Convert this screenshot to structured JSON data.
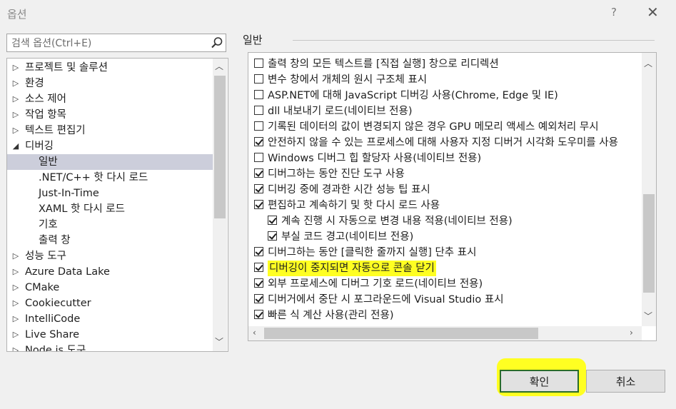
{
  "window": {
    "title": "옵션",
    "help": "?",
    "close": "✕"
  },
  "search": {
    "placeholder": "검색 옵션(Ctrl+E)"
  },
  "tree": {
    "items": [
      {
        "label": "프로젝트 및 솔루션",
        "arrow": "▷",
        "indent": 0
      },
      {
        "label": "환경",
        "arrow": "▷",
        "indent": 0
      },
      {
        "label": "소스 제어",
        "arrow": "▷",
        "indent": 0
      },
      {
        "label": "작업 항목",
        "arrow": "▷",
        "indent": 0
      },
      {
        "label": "텍스트 편집기",
        "arrow": "▷",
        "indent": 0
      },
      {
        "label": "디버깅",
        "arrow": "◢",
        "indent": 0
      },
      {
        "label": "일반",
        "arrow": "",
        "indent": 1,
        "selected": true
      },
      {
        "label": ".NET/C++ 핫 다시 로드",
        "arrow": "",
        "indent": 1
      },
      {
        "label": "Just-In-Time",
        "arrow": "",
        "indent": 1
      },
      {
        "label": "XAML 핫 다시 로드",
        "arrow": "",
        "indent": 1
      },
      {
        "label": "기호",
        "arrow": "",
        "indent": 1
      },
      {
        "label": "출력 창",
        "arrow": "",
        "indent": 1
      },
      {
        "label": "성능 도구",
        "arrow": "▷",
        "indent": 0
      },
      {
        "label": "Azure Data Lake",
        "arrow": "▷",
        "indent": 0
      },
      {
        "label": "CMake",
        "arrow": "▷",
        "indent": 0
      },
      {
        "label": "Cookiecutter",
        "arrow": "▷",
        "indent": 0
      },
      {
        "label": "IntelliCode",
        "arrow": "▷",
        "indent": 0
      },
      {
        "label": "Live Share",
        "arrow": "▷",
        "indent": 0
      },
      {
        "label": "Node.js 도구",
        "arrow": "▷",
        "indent": 0
      }
    ]
  },
  "section": {
    "title": "일반"
  },
  "options": [
    {
      "label": "출력 창의 모든 텍스트를 [직접 실행] 창으로 리디렉션",
      "checked": false,
      "indent": 0
    },
    {
      "label": "변수 창에서 개체의 원시 구조체 표시",
      "checked": false,
      "indent": 0
    },
    {
      "label": "ASP.NET에 대해 JavaScript 디버깅 사용(Chrome, Edge 및 IE)",
      "checked": false,
      "indent": 0
    },
    {
      "label": "dll 내보내기 로드(네이티브 전용)",
      "checked": false,
      "indent": 0
    },
    {
      "label": "기록된 데이터의 값이 변경되지 않은 경우 GPU 메모리 액세스 예외처리 무시",
      "checked": false,
      "indent": 0
    },
    {
      "label": "안전하지 않을 수 있는 프로세스에 대해 사용자 지정 디버거 시각화 도우미를 사용",
      "checked": true,
      "indent": 0
    },
    {
      "label": "Windows 디버그 힙 할당자 사용(네이티브 전용)",
      "checked": false,
      "indent": 0
    },
    {
      "label": "디버그하는 동안 진단 도구 사용",
      "checked": true,
      "indent": 0
    },
    {
      "label": "디버깅 중에 경과한 시간 성능 팁 표시",
      "checked": true,
      "indent": 0
    },
    {
      "label": "편집하고 계속하기 및 핫 다시 로드 사용",
      "checked": true,
      "indent": 0
    },
    {
      "label": "계속 진행 시 자동으로 변경 내용 적용(네이티브 전용)",
      "checked": true,
      "indent": 1
    },
    {
      "label": "부실 코드 경고(네이티브 전용)",
      "checked": true,
      "indent": 1
    },
    {
      "label": "디버그하는 동안 [클릭한 줄까지 실행] 단추 표시",
      "checked": true,
      "indent": 0
    },
    {
      "label": "디버깅이 중지되면 자동으로 콘솔 닫기",
      "checked": true,
      "indent": 0,
      "highlight": true
    },
    {
      "label": "외부 프로세스에 디버그 기호 로드(네이티브 전용)",
      "checked": true,
      "indent": 0
    },
    {
      "label": "디버거에서 중단 시 포그라운드에 Visual Studio 표시",
      "checked": true,
      "indent": 0
    },
    {
      "label": "빠른 식 계산 사용(관리 전용)",
      "checked": true,
      "indent": 0
    }
  ],
  "buttons": {
    "ok": "확인",
    "cancel": "취소"
  },
  "scroll": {
    "up": "︿",
    "down": "﹀",
    "left": "‹",
    "right": "›"
  },
  "colors": {
    "highlight": "#ffff22",
    "selected_row": "#cccedb",
    "ok_border": "#2a6c2a"
  }
}
